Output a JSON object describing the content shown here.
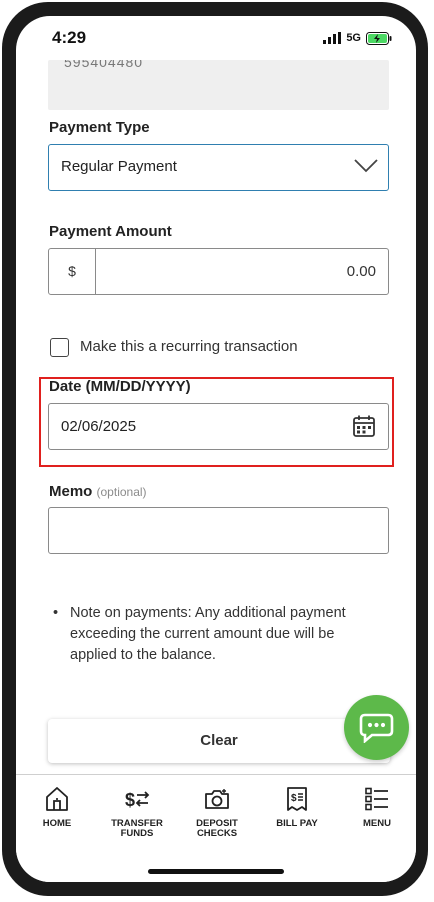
{
  "status_bar": {
    "time": "4:29",
    "network": "5G"
  },
  "previous_field": {
    "value": "595404480"
  },
  "payment_type": {
    "label": "Payment Type",
    "value": "Regular Payment"
  },
  "payment_amount": {
    "label": "Payment Amount",
    "currency": "$",
    "value": "0.00"
  },
  "recurring": {
    "label": "Make this a recurring transaction",
    "checked": false
  },
  "date": {
    "label": "Date (MM/DD/YYYY)",
    "value": "02/06/2025"
  },
  "memo": {
    "label": "Memo",
    "optional": "(optional)",
    "value": ""
  },
  "note": {
    "bullet": "•",
    "text": "Note on payments: Any additional payment exceeding the current amount due will be applied to the balance."
  },
  "clear_button": {
    "label": "Clear"
  },
  "tabs": [
    {
      "label": "HOME",
      "icon": "home-icon"
    },
    {
      "label": "TRANSFER\nFUNDS",
      "icon": "transfer-icon"
    },
    {
      "label": "DEPOSIT\nCHECKS",
      "icon": "camera-icon"
    },
    {
      "label": "BILL PAY",
      "icon": "bill-icon"
    },
    {
      "label": "MENU",
      "icon": "menu-list-icon"
    }
  ],
  "colors": {
    "accent_blue": "#2f7fb0",
    "highlight_red": "#e0201e",
    "chat_green": "#5db94a"
  }
}
